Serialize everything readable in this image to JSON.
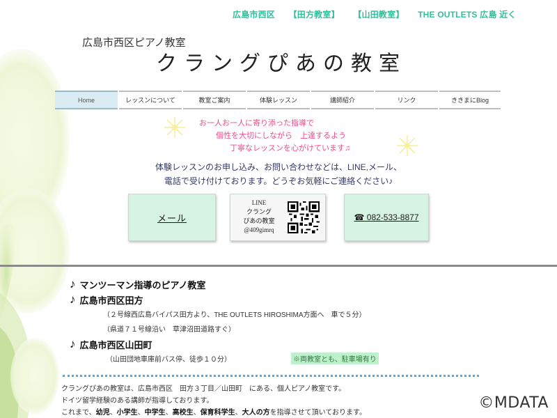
{
  "header": {
    "tagline": [
      "広島市西区",
      "【田方教室】",
      "【山田教室】",
      "THE OUTLETS 広島 近く"
    ],
    "subtitle": "広島市西区ピアノ教室",
    "title": "クラングぴあの教室"
  },
  "nav": {
    "items": [
      {
        "label": "Home",
        "active": true
      },
      {
        "label": "レッスンについて"
      },
      {
        "label": "教室ご案内"
      },
      {
        "label": "体験レッスン"
      },
      {
        "label": "講師紹介"
      },
      {
        "label": "リンク"
      },
      {
        "label": "ききまにBlog"
      }
    ]
  },
  "intro": {
    "lines": [
      "お一人お一人に寄り添った指導で",
      "個性を大切にしながら　上達するよう",
      "丁寧なレッスンを心がけています♫"
    ],
    "contact_lines": [
      "体験レッスンのお申し込み、お問い合わせなどは、LINE,メール、",
      "電話で受け付けております。どうぞお気軽にご連絡ください♪"
    ]
  },
  "buttons": {
    "mail": "メール",
    "line": [
      "LINE",
      "クラング",
      "ぴあの教室",
      "@409gimrq"
    ],
    "tel": "☎ 082-533-8877"
  },
  "info": {
    "head1": "マンツーマン指導のピアノ教室",
    "head2": "広島市西区田方",
    "tagata_lines": [
      "（２号線西広島バイパス田方より、THE OUTLETS HIROSHIMA方面へ　車で５分）",
      "（県道７１号線沿い　草津沼田道路すぐ）"
    ],
    "head3": "広島市西区山田町",
    "yamada_line": "（山田団地車庫前バス停、徒歩１０分）",
    "parking": "※両教室とも、駐車場有り"
  },
  "description": {
    "line1": "クラングぴあの教室は、広島市西区　田方３丁目／山田町　にある、個人ピアノ教室です。",
    "line2": "ドイツ留学経験のある講師が指導しております。",
    "line3_prefix": "これまで、",
    "line3_bold": [
      "幼児",
      "小学生",
      "中学生",
      "高校生",
      "保育科学生",
      "大人の方"
    ],
    "line3_suffix": "を指導させて頂いております。"
  },
  "watermark": "©MDATA",
  "colors": {
    "accent_teal": "#2fbf9a",
    "pink_text": "#ee4b8a",
    "card_green": "#d6f3e3",
    "nav_active": "#d9ecf3"
  }
}
